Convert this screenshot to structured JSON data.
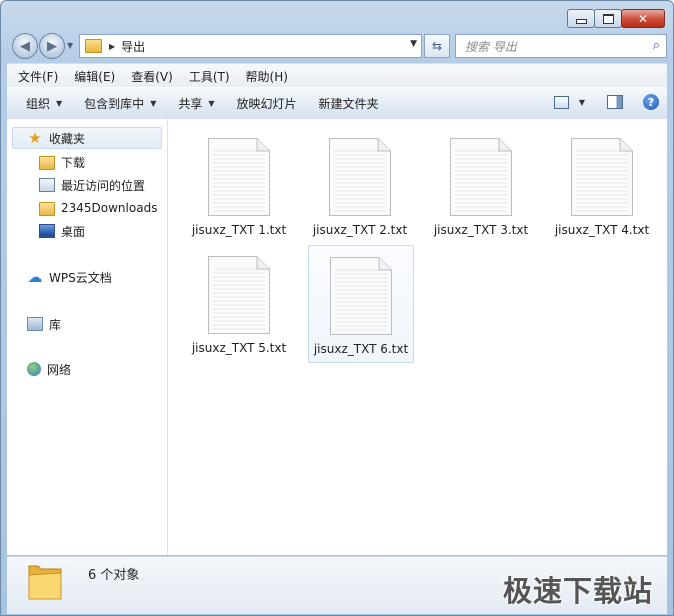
{
  "window": {
    "buttons": {
      "minimize": "minimize-icon",
      "maximize": "maximize-icon",
      "close": "close-icon"
    }
  },
  "address": {
    "path": "导出",
    "search_placeholder": "搜索 导出"
  },
  "menu": [
    {
      "label": "文件(F)"
    },
    {
      "label": "编辑(E)"
    },
    {
      "label": "查看(V)"
    },
    {
      "label": "工具(T)"
    },
    {
      "label": "帮助(H)"
    }
  ],
  "toolbar": {
    "organize": "组织",
    "include_library": "包含到库中",
    "share": "共享",
    "slideshow": "放映幻灯片",
    "new_folder": "新建文件夹"
  },
  "nav": {
    "favorites": "收藏夹",
    "downloads": "下载",
    "recent": "最近访问的位置",
    "downloads2345": "2345Downloads",
    "desktop": "桌面",
    "wps": "WPS云文档",
    "library": "库",
    "network": "网络"
  },
  "files": [
    {
      "name": "jisuxz_TXT 1.txt"
    },
    {
      "name": "jisuxz_TXT 2.txt"
    },
    {
      "name": "jisuxz_TXT 3.txt"
    },
    {
      "name": "jisuxz_TXT 4.txt"
    },
    {
      "name": "jisuxz_TXT 5.txt"
    },
    {
      "name": "jisuxz_TXT 6.txt",
      "selected": true
    }
  ],
  "status": {
    "count": "6 个对象",
    "watermark": "极速下载站"
  },
  "colors": {
    "accent": "#1d58b8",
    "selection": "#c4dcf2"
  }
}
